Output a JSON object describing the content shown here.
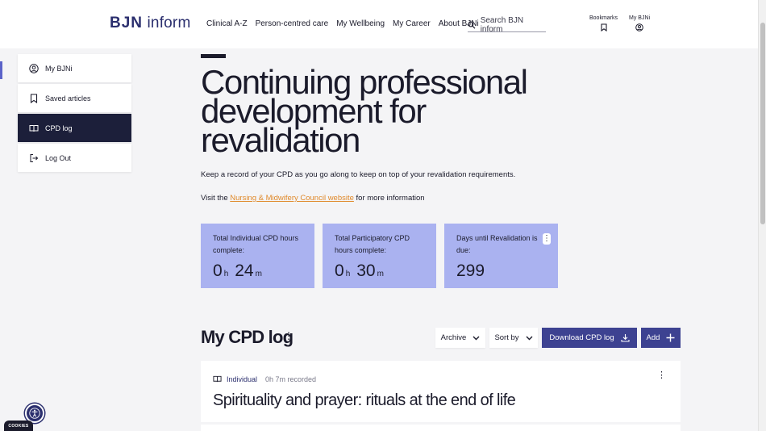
{
  "header": {
    "logo_bold": "BJN",
    "logo_rest": "inform",
    "nav": [
      "Clinical A-Z",
      "Person-centred care",
      "My Wellbeing",
      "My Career",
      "About BJNi"
    ],
    "search_placeholder": "Search BJN inform",
    "bookmarks_label": "Bookmarks",
    "account_label": "My BJNi"
  },
  "sidebar": {
    "items": [
      {
        "label": "My BJNi",
        "icon": "user-circle-icon"
      },
      {
        "label": "Saved articles",
        "icon": "bookmark-icon"
      },
      {
        "label": "CPD log",
        "icon": "open-book-icon",
        "active": true
      },
      {
        "label": "Log Out",
        "icon": "logout-icon"
      }
    ]
  },
  "hero": {
    "title": "Continuing professional development for revalidation",
    "intro": "Keep a record of your CPD as you go along to keep on top of your revalidation requirements.",
    "visit_prefix": "Visit the ",
    "visit_link": "Nursing & Midwifery Council website",
    "visit_suffix": " for more information"
  },
  "stats": [
    {
      "label": "Total Individual CPD hours complete:",
      "hours": "0",
      "hours_unit": "h",
      "minutes": "24",
      "minutes_unit": "m"
    },
    {
      "label": "Total Participatory CPD hours complete:",
      "hours": "0",
      "hours_unit": "h",
      "minutes": "30",
      "minutes_unit": "m"
    },
    {
      "label": "Days until Revalidation is due:",
      "value": "299"
    }
  ],
  "log": {
    "title": "My CPD log",
    "archive_label": "Archive",
    "sort_label": "Sort by",
    "download_label": "Download CPD log",
    "add_label": "Add"
  },
  "entries": [
    {
      "type": "Individual",
      "recorded": "0h 7m recorded",
      "title": "Spirituality and prayer: rituals at the end of life"
    }
  ],
  "cookies_label": "COOKIES",
  "colors": {
    "accent": "#3d4291",
    "card": "#aab2f0",
    "active_nav": "#1c1f3a",
    "link": "#e08a2c"
  }
}
